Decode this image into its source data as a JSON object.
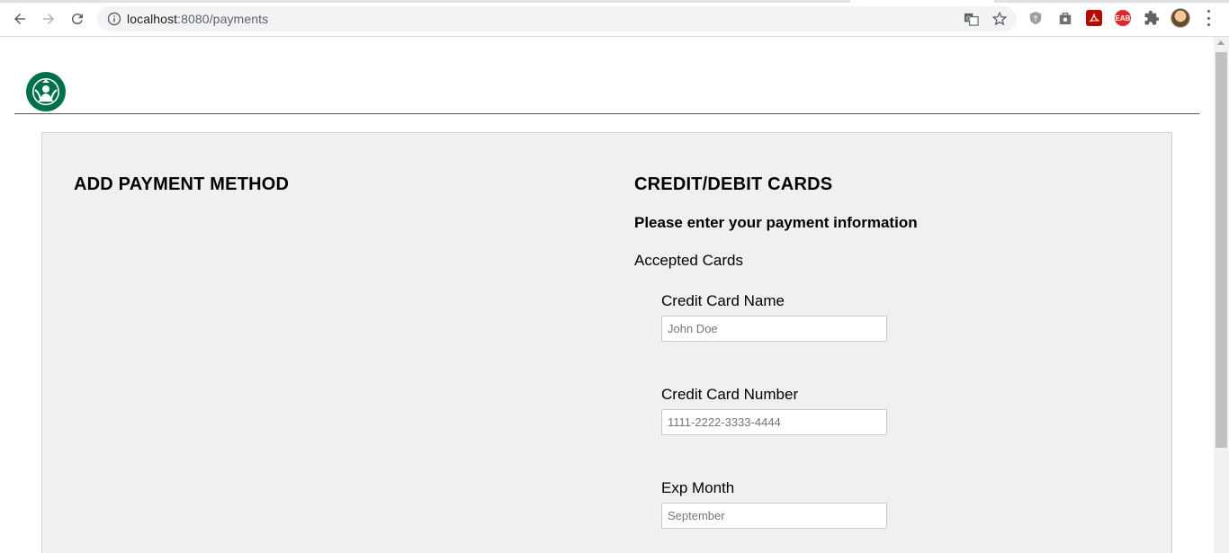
{
  "browser": {
    "url_host": "localhost",
    "url_port_path": ":8080/payments",
    "icons": {
      "back": "back-arrow-icon",
      "forward": "forward-arrow-icon",
      "reload": "reload-icon",
      "site_info": "info-icon",
      "translate": "translate-icon",
      "bookmark": "star-icon"
    },
    "extensions": [
      "shield-extension-icon",
      "bag-extension-icon",
      "pdf-extension-icon",
      "eab-extension-icon",
      "puzzle-extensions-icon"
    ],
    "eab_label": "EAB"
  },
  "page": {
    "left_title": "ADD PAYMENT METHOD",
    "right_title": "CREDIT/DEBIT CARDS",
    "subtitle": "Please enter your payment information",
    "accepted_cards_label": "Accepted Cards",
    "fields": [
      {
        "label": "Credit Card Name",
        "placeholder": "John Doe"
      },
      {
        "label": "Credit Card Number",
        "placeholder": "1111-2222-3333-4444"
      },
      {
        "label": "Exp Month",
        "placeholder": "September"
      }
    ]
  },
  "colors": {
    "brand_green": "#00704a",
    "panel_bg": "#f0f0f0"
  }
}
